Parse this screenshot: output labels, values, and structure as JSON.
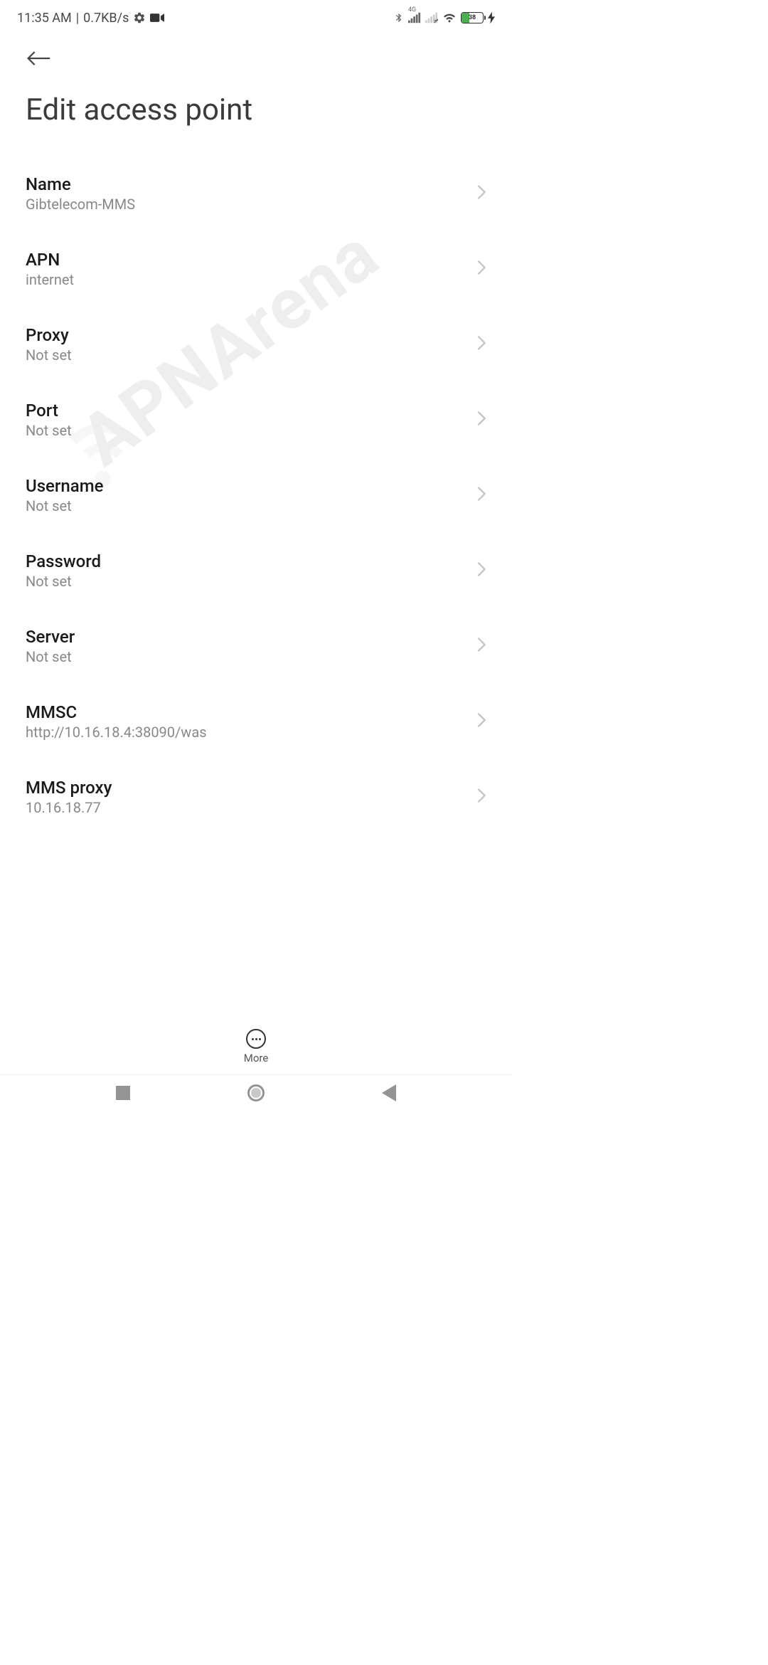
{
  "status_bar": {
    "time": "11:35 AM",
    "separator": " | ",
    "data_rate": "0.7KB/s",
    "battery_percent": "38",
    "network_label": "4G"
  },
  "header": {
    "title": "Edit access point"
  },
  "settings": [
    {
      "label": "Name",
      "value": "Gibtelecom-MMS"
    },
    {
      "label": "APN",
      "value": "internet"
    },
    {
      "label": "Proxy",
      "value": "Not set"
    },
    {
      "label": "Port",
      "value": "Not set"
    },
    {
      "label": "Username",
      "value": "Not set"
    },
    {
      "label": "Password",
      "value": "Not set"
    },
    {
      "label": "Server",
      "value": "Not set"
    },
    {
      "label": "MMSC",
      "value": "http://10.16.18.4:38090/was"
    },
    {
      "label": "MMS proxy",
      "value": "10.16.18.77"
    }
  ],
  "toolbar": {
    "more_label": "More"
  },
  "watermark": "APNArena"
}
